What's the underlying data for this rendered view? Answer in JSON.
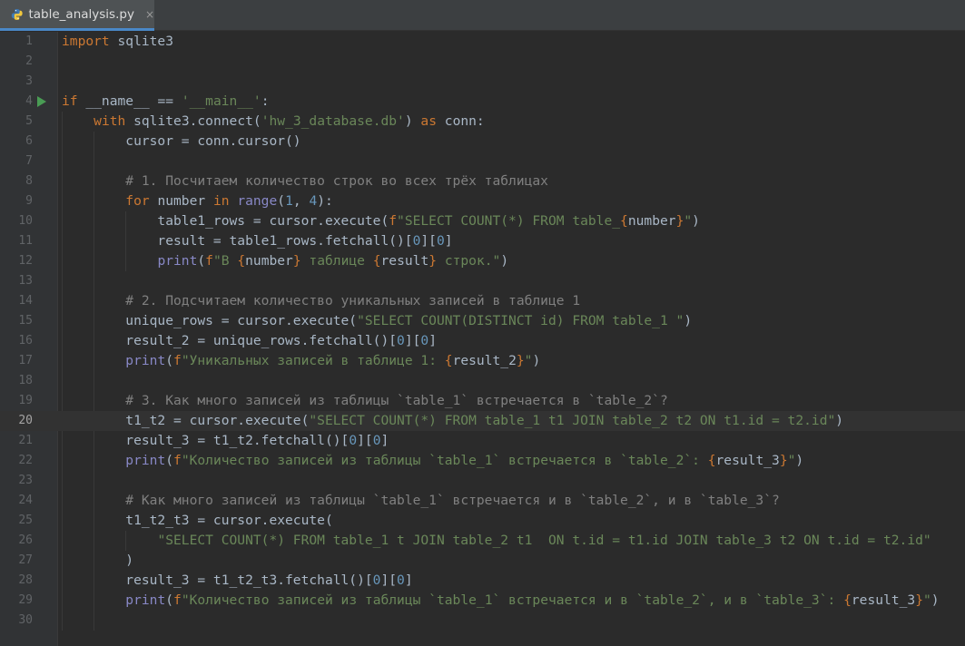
{
  "tab": {
    "filename": "table_analysis.py",
    "close_glyph": "×",
    "icon": "python-file-icon"
  },
  "editor": {
    "current_line": 20,
    "lines": [
      {
        "n": "1",
        "tokens": [
          [
            "kw",
            "import"
          ],
          [
            "pl",
            " sqlite3"
          ]
        ]
      },
      {
        "n": "2",
        "tokens": []
      },
      {
        "n": "3",
        "tokens": []
      },
      {
        "n": "4",
        "tokens": [
          [
            "kw",
            "if"
          ],
          [
            "pl",
            " __name__ == "
          ],
          [
            "str",
            "'__main__'"
          ],
          [
            "pl",
            ":"
          ]
        ],
        "run": true
      },
      {
        "n": "5",
        "tokens": [
          [
            "pl",
            "    "
          ],
          [
            "kw",
            "with"
          ],
          [
            "pl",
            " sqlite3.connect("
          ],
          [
            "str",
            "'hw_3_database.db'"
          ],
          [
            "pl",
            ") "
          ],
          [
            "kw",
            "as"
          ],
          [
            "pl",
            " conn:"
          ]
        ]
      },
      {
        "n": "6",
        "tokens": [
          [
            "pl",
            "        cursor = conn.cursor()"
          ]
        ]
      },
      {
        "n": "7",
        "tokens": []
      },
      {
        "n": "8",
        "tokens": [
          [
            "pl",
            "        "
          ],
          [
            "cm",
            "# 1. Посчитаем количество строк во всех трёх таблицах"
          ]
        ]
      },
      {
        "n": "9",
        "tokens": [
          [
            "pl",
            "        "
          ],
          [
            "kw",
            "for"
          ],
          [
            "pl",
            " number "
          ],
          [
            "kw",
            "in"
          ],
          [
            "pl",
            " "
          ],
          [
            "bi",
            "range"
          ],
          [
            "pl",
            "("
          ],
          [
            "num",
            "1"
          ],
          [
            "pl",
            ", "
          ],
          [
            "num",
            "4"
          ],
          [
            "pl",
            "):"
          ]
        ]
      },
      {
        "n": "10",
        "tokens": [
          [
            "pl",
            "            table1_rows = cursor.execute("
          ],
          [
            "kw",
            "f"
          ],
          [
            "str",
            "\"SELECT COUNT(*) FROM table_"
          ],
          [
            "kw",
            "{"
          ],
          [
            "pl",
            "number"
          ],
          [
            "kw",
            "}"
          ],
          [
            "str",
            "\""
          ],
          [
            "pl",
            ")"
          ]
        ]
      },
      {
        "n": "11",
        "tokens": [
          [
            "pl",
            "            result = table1_rows.fetchall()["
          ],
          [
            "num",
            "0"
          ],
          [
            "pl",
            "]["
          ],
          [
            "num",
            "0"
          ],
          [
            "pl",
            "]"
          ]
        ]
      },
      {
        "n": "12",
        "tokens": [
          [
            "pl",
            "            "
          ],
          [
            "bi",
            "print"
          ],
          [
            "pl",
            "("
          ],
          [
            "kw",
            "f"
          ],
          [
            "str",
            "\"В "
          ],
          [
            "kw",
            "{"
          ],
          [
            "pl",
            "number"
          ],
          [
            "kw",
            "}"
          ],
          [
            "str",
            " таблице "
          ],
          [
            "kw",
            "{"
          ],
          [
            "pl",
            "result"
          ],
          [
            "kw",
            "}"
          ],
          [
            "str",
            " строк.\""
          ],
          [
            "pl",
            ")"
          ]
        ]
      },
      {
        "n": "13",
        "tokens": []
      },
      {
        "n": "14",
        "tokens": [
          [
            "pl",
            "        "
          ],
          [
            "cm",
            "# 2. Подсчитаем количество уникальных записей в таблице 1"
          ]
        ]
      },
      {
        "n": "15",
        "tokens": [
          [
            "pl",
            "        unique_rows = cursor.execute("
          ],
          [
            "str",
            "\"SELECT COUNT(DISTINCT id) FROM table_1 \""
          ],
          [
            "pl",
            ")"
          ]
        ]
      },
      {
        "n": "16",
        "tokens": [
          [
            "pl",
            "        result_2 = unique_rows.fetchall()["
          ],
          [
            "num",
            "0"
          ],
          [
            "pl",
            "]["
          ],
          [
            "num",
            "0"
          ],
          [
            "pl",
            "]"
          ]
        ]
      },
      {
        "n": "17",
        "tokens": [
          [
            "pl",
            "        "
          ],
          [
            "bi",
            "print"
          ],
          [
            "pl",
            "("
          ],
          [
            "kw",
            "f"
          ],
          [
            "str",
            "\"Уникальных записей в таблице 1: "
          ],
          [
            "kw",
            "{"
          ],
          [
            "pl",
            "result_2"
          ],
          [
            "kw",
            "}"
          ],
          [
            "str",
            "\""
          ],
          [
            "pl",
            ")"
          ]
        ]
      },
      {
        "n": "18",
        "tokens": []
      },
      {
        "n": "19",
        "tokens": [
          [
            "pl",
            "        "
          ],
          [
            "cm",
            "# 3. Как много записей из таблицы `table_1` встречается в `table_2`?"
          ]
        ]
      },
      {
        "n": "20",
        "tokens": [
          [
            "pl",
            "        t1_t2 = cursor.execute("
          ],
          [
            "str",
            "\"SELECT COUNT(*) FROM table_1 t1 JOIN table_2 t2 ON t1.id = t2.id\""
          ],
          [
            "pl",
            ")"
          ]
        ]
      },
      {
        "n": "21",
        "tokens": [
          [
            "pl",
            "        result_3 = t1_t2.fetchall()["
          ],
          [
            "num",
            "0"
          ],
          [
            "pl",
            "]["
          ],
          [
            "num",
            "0"
          ],
          [
            "pl",
            "]"
          ]
        ]
      },
      {
        "n": "22",
        "tokens": [
          [
            "pl",
            "        "
          ],
          [
            "bi",
            "print"
          ],
          [
            "pl",
            "("
          ],
          [
            "kw",
            "f"
          ],
          [
            "str",
            "\"Количество записей из таблицы `table_1` встречается в `table_2`: "
          ],
          [
            "kw",
            "{"
          ],
          [
            "pl",
            "result_3"
          ],
          [
            "kw",
            "}"
          ],
          [
            "str",
            "\""
          ],
          [
            "pl",
            ")"
          ]
        ]
      },
      {
        "n": "23",
        "tokens": []
      },
      {
        "n": "24",
        "tokens": [
          [
            "pl",
            "        "
          ],
          [
            "cm",
            "# Как много записей из таблицы `table_1` встречается и в `table_2`, и в `table_3`?"
          ]
        ]
      },
      {
        "n": "25",
        "tokens": [
          [
            "pl",
            "        t1_t2_t3 = cursor.execute("
          ]
        ]
      },
      {
        "n": "26",
        "tokens": [
          [
            "pl",
            "            "
          ],
          [
            "str",
            "\"SELECT COUNT(*) FROM table_1 t JOIN table_2 t1  ON t.id = t1.id JOIN table_3 t2 ON t.id = t2.id\""
          ]
        ]
      },
      {
        "n": "27",
        "tokens": [
          [
            "pl",
            "        )"
          ]
        ]
      },
      {
        "n": "28",
        "tokens": [
          [
            "pl",
            "        result_3 = t1_t2_t3.fetchall()["
          ],
          [
            "num",
            "0"
          ],
          [
            "pl",
            "]["
          ],
          [
            "num",
            "0"
          ],
          [
            "pl",
            "]"
          ]
        ]
      },
      {
        "n": "29",
        "tokens": [
          [
            "pl",
            "        "
          ],
          [
            "bi",
            "print"
          ],
          [
            "pl",
            "("
          ],
          [
            "kw",
            "f"
          ],
          [
            "str",
            "\"Количество записей из таблицы `table_1` встречается и в `table_2`, и в `table_3`: "
          ],
          [
            "kw",
            "{"
          ],
          [
            "pl",
            "result_3"
          ],
          [
            "kw",
            "}"
          ],
          [
            "str",
            "\""
          ],
          [
            "pl",
            ")"
          ]
        ]
      },
      {
        "n": "30",
        "tokens": []
      }
    ]
  }
}
